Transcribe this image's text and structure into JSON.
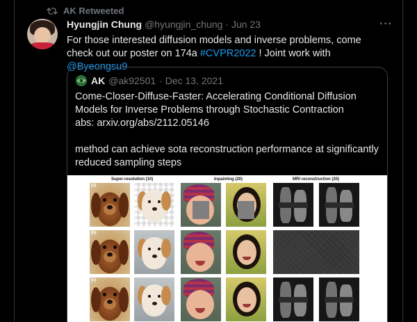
{
  "retweet": {
    "label": "AK Retweeted"
  },
  "tweet": {
    "author_name": "Hyungjin Chung",
    "author_handle": "@hyungjin_chung",
    "date": "· Jun 23",
    "more_label": "···",
    "text_prefix": "For those interested diffusion models and inverse problems, come check out our poster on 174a ",
    "hashtag": "#CVPR2022",
    "text_middle": " ! Joint work with ",
    "mention": "@Byeongsu9"
  },
  "quote": {
    "author_name": "AK",
    "author_handle": "@ak92501",
    "date": "· Dec 13, 2021",
    "paragraph1": "Come-Closer-Diffuse-Faster: Accelerating Conditional Diffusion Models for Inverse Problems through Stochastic Contraction",
    "link_line": "abs: arxiv.org/abs/2112.05146",
    "paragraph2": "method can achieve sota reconstruction performance at significantly reduced sampling steps"
  },
  "figure": {
    "col_super": "Super-resolution (10)",
    "col_inpaint": "Inpainting (20)",
    "col_mri": "MRI reconstruction (20)",
    "row_a": "(a)",
    "row_b": "(b)",
    "row_c": "(c)"
  },
  "colors": {
    "background": "#000000",
    "text": "#e7e9ea",
    "muted": "#71767b",
    "link": "#1d9bf0",
    "border": "#2f3336"
  }
}
